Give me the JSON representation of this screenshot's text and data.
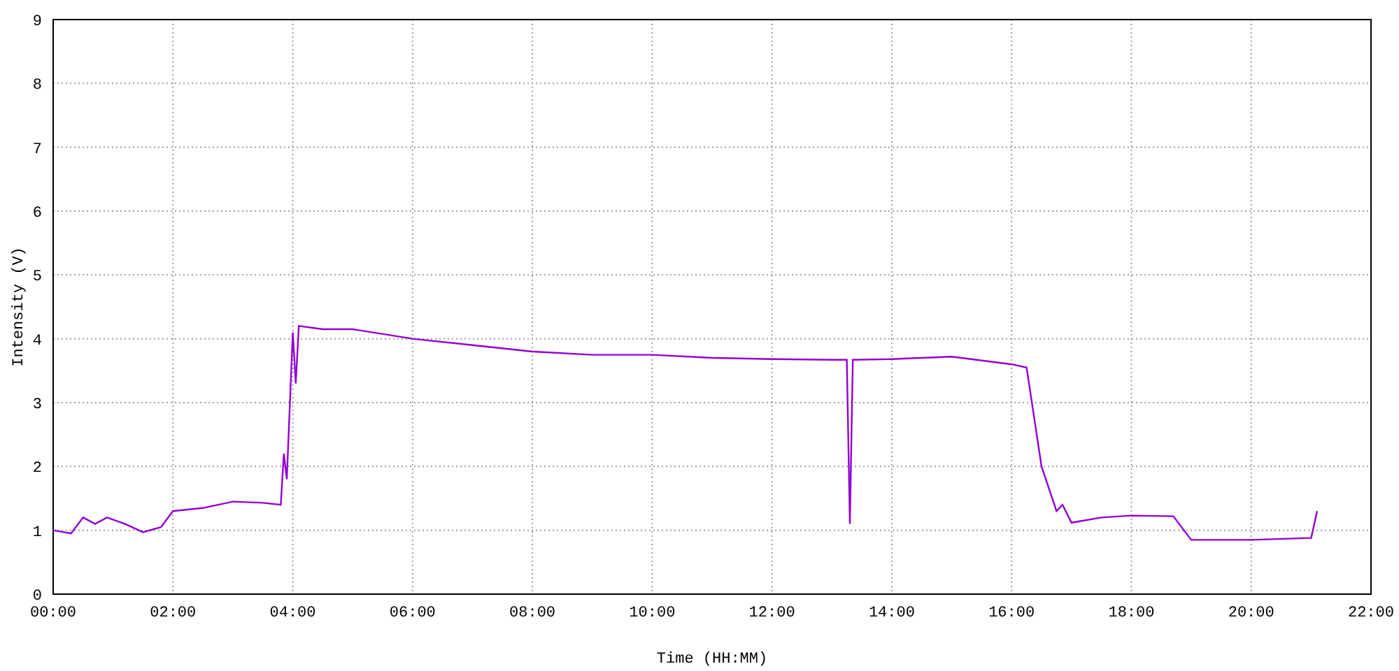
{
  "chart_data": {
    "type": "line",
    "xlabel": "Time (HH:MM)",
    "ylabel": "Intensity (V)",
    "grid": true,
    "xlim": [
      0,
      22
    ],
    "ylim": [
      0,
      9
    ],
    "xticks": [
      {
        "value": 0,
        "label": "00:00"
      },
      {
        "value": 2,
        "label": "02:00"
      },
      {
        "value": 4,
        "label": "04:00"
      },
      {
        "value": 6,
        "label": "06:00"
      },
      {
        "value": 8,
        "label": "08:00"
      },
      {
        "value": 10,
        "label": "10:00"
      },
      {
        "value": 12,
        "label": "12:00"
      },
      {
        "value": 14,
        "label": "14:00"
      },
      {
        "value": 16,
        "label": "16:00"
      },
      {
        "value": 18,
        "label": "18:00"
      },
      {
        "value": 20,
        "label": "20:00"
      },
      {
        "value": 22,
        "label": "22:00"
      }
    ],
    "yticks": [
      0,
      1,
      2,
      3,
      4,
      5,
      6,
      7,
      8,
      9
    ],
    "x": [
      0,
      0.3,
      0.5,
      0.7,
      0.9,
      1.2,
      1.5,
      1.8,
      2.0,
      2.5,
      3.0,
      3.5,
      3.8,
      3.85,
      3.9,
      4.0,
      4.05,
      4.1,
      4.5,
      5.0,
      6.0,
      7.0,
      8.0,
      9.0,
      10.0,
      11.0,
      12.0,
      13.0,
      13.25,
      13.3,
      13.35,
      14.0,
      15.0,
      16.0,
      16.25,
      16.5,
      16.75,
      16.85,
      17.0,
      17.5,
      18.0,
      18.7,
      19.0,
      20.0,
      21.0,
      21.1
    ],
    "series": [
      {
        "color": "#9400d3",
        "values": [
          1.0,
          0.95,
          1.2,
          1.1,
          1.2,
          1.1,
          0.97,
          1.05,
          1.3,
          1.35,
          1.45,
          1.43,
          1.4,
          2.2,
          1.8,
          4.1,
          3.3,
          4.2,
          4.15,
          4.15,
          4.0,
          3.9,
          3.8,
          3.75,
          3.75,
          3.7,
          3.68,
          3.67,
          3.67,
          1.1,
          3.67,
          3.68,
          3.72,
          3.6,
          3.55,
          2.0,
          1.3,
          1.4,
          1.12,
          1.2,
          1.23,
          1.22,
          0.85,
          0.85,
          0.88,
          1.3
        ]
      }
    ]
  }
}
